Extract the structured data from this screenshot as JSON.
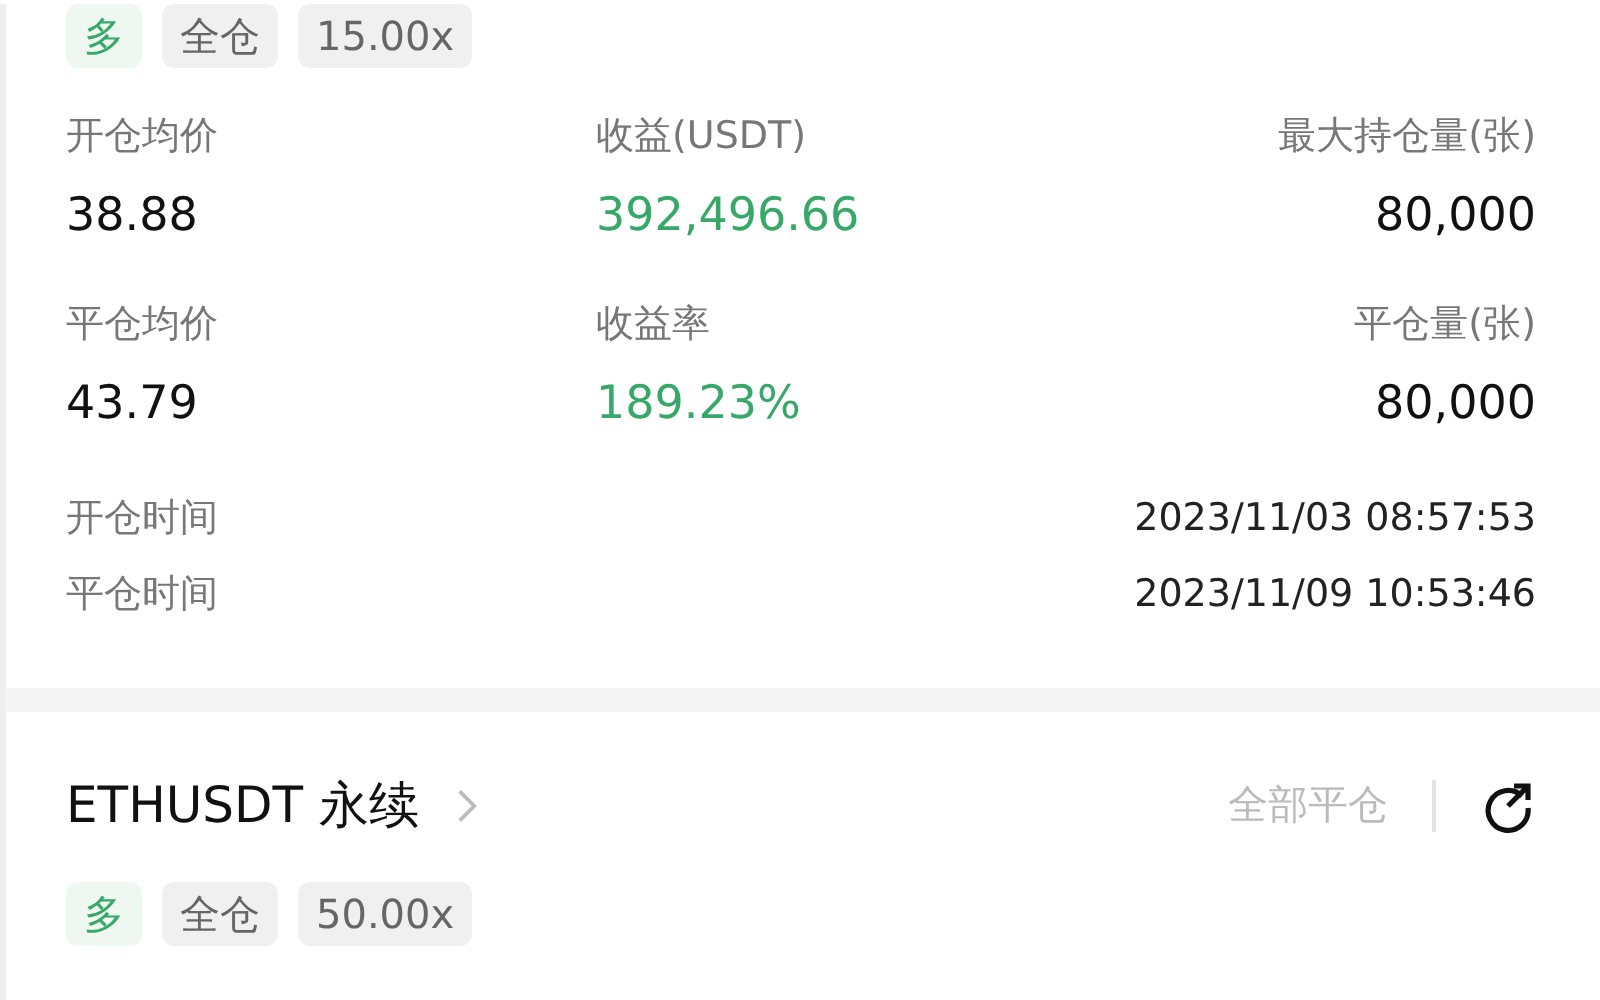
{
  "positions": [
    {
      "tags": [
        {
          "kind": "side",
          "text": "多"
        },
        {
          "kind": "plain",
          "text": "全仓"
        },
        {
          "kind": "plain",
          "text": "15.00x"
        }
      ],
      "stats": [
        {
          "label": "开仓均价",
          "value": "38.88",
          "kind": "plain"
        },
        {
          "label": "收益(USDT)",
          "value": "392,496.66",
          "kind": "profit"
        },
        {
          "label": "最大持仓量(张)",
          "value": "80,000",
          "kind": "plain"
        },
        {
          "label": "平仓均价",
          "value": "43.79",
          "kind": "plain"
        },
        {
          "label": "收益率",
          "value": "189.23%",
          "kind": "profit"
        },
        {
          "label": "平仓量(张)",
          "value": "80,000",
          "kind": "plain"
        }
      ],
      "times": [
        {
          "label": "开仓时间",
          "value": "2023/11/03 08:57:53"
        },
        {
          "label": "平仓时间",
          "value": "2023/11/09 10:53:46"
        }
      ]
    },
    {
      "symbol": "ETHUSDT 永续",
      "close_all": "全部平仓",
      "tags": [
        {
          "kind": "side",
          "text": "多"
        },
        {
          "kind": "plain",
          "text": "全仓"
        },
        {
          "kind": "plain",
          "text": "50.00x"
        }
      ]
    }
  ]
}
